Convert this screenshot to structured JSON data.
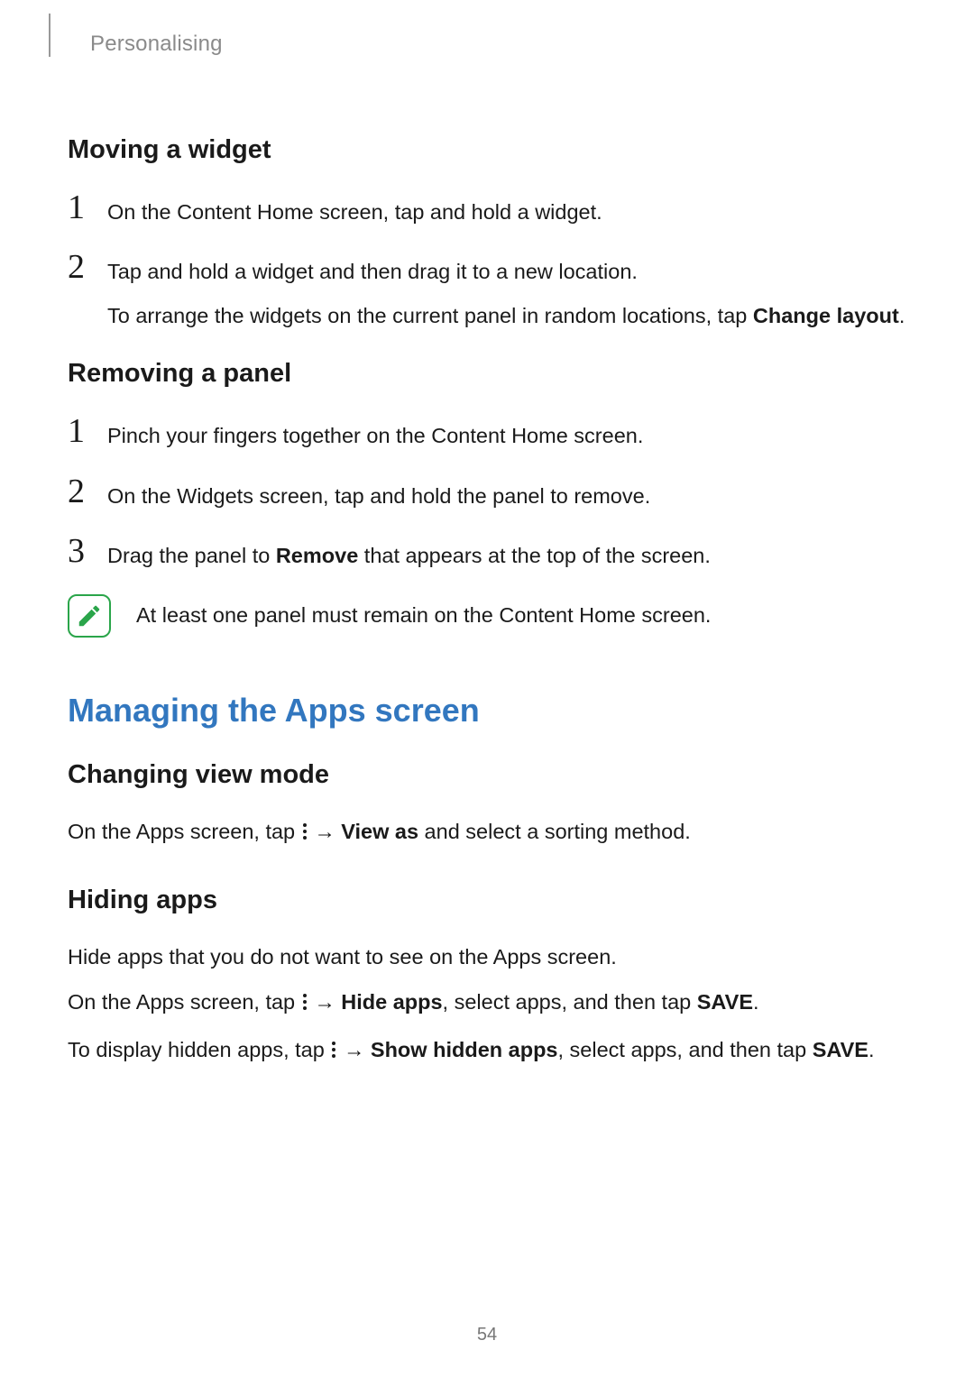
{
  "breadcrumb": "Personalising",
  "section1": {
    "heading": "Moving a widget",
    "step1": "On the Content Home screen, tap and hold a widget.",
    "step2_a": "Tap and hold a widget and then drag it to a new location.",
    "step2_b_pre": "To arrange the widgets on the current panel in random locations, tap ",
    "step2_b_bold": "Change layout",
    "step2_b_post": "."
  },
  "section2": {
    "heading": "Removing a panel",
    "step1": "Pinch your fingers together on the Content Home screen.",
    "step2": "On the Widgets screen, tap and hold the panel to remove.",
    "step3_pre": "Drag the panel to ",
    "step3_bold": "Remove",
    "step3_post": " that appears at the top of the screen.",
    "note": "At least one panel must remain on the Content Home screen."
  },
  "h2": "Managing the Apps screen",
  "section3": {
    "heading": "Changing view mode",
    "p_pre": "On the Apps screen, tap ",
    "p_arrow": " → ",
    "p_bold": "View as",
    "p_post": " and select a sorting method."
  },
  "section4": {
    "heading": "Hiding apps",
    "p1": "Hide apps that you do not want to see on the Apps screen.",
    "p2_pre": "On the Apps screen, tap ",
    "arrow": " → ",
    "p2_bold": "Hide apps",
    "p2_mid": ", select apps, and then tap ",
    "save": "SAVE",
    "p2_post": ".",
    "p3_pre": "To display hidden apps, tap ",
    "p3_bold": "Show hidden apps",
    "p3_mid": ", select apps, and then tap ",
    "p3_post": "."
  },
  "numbers": {
    "n1": "1",
    "n2": "2",
    "n3": "3"
  },
  "page_number": "54"
}
